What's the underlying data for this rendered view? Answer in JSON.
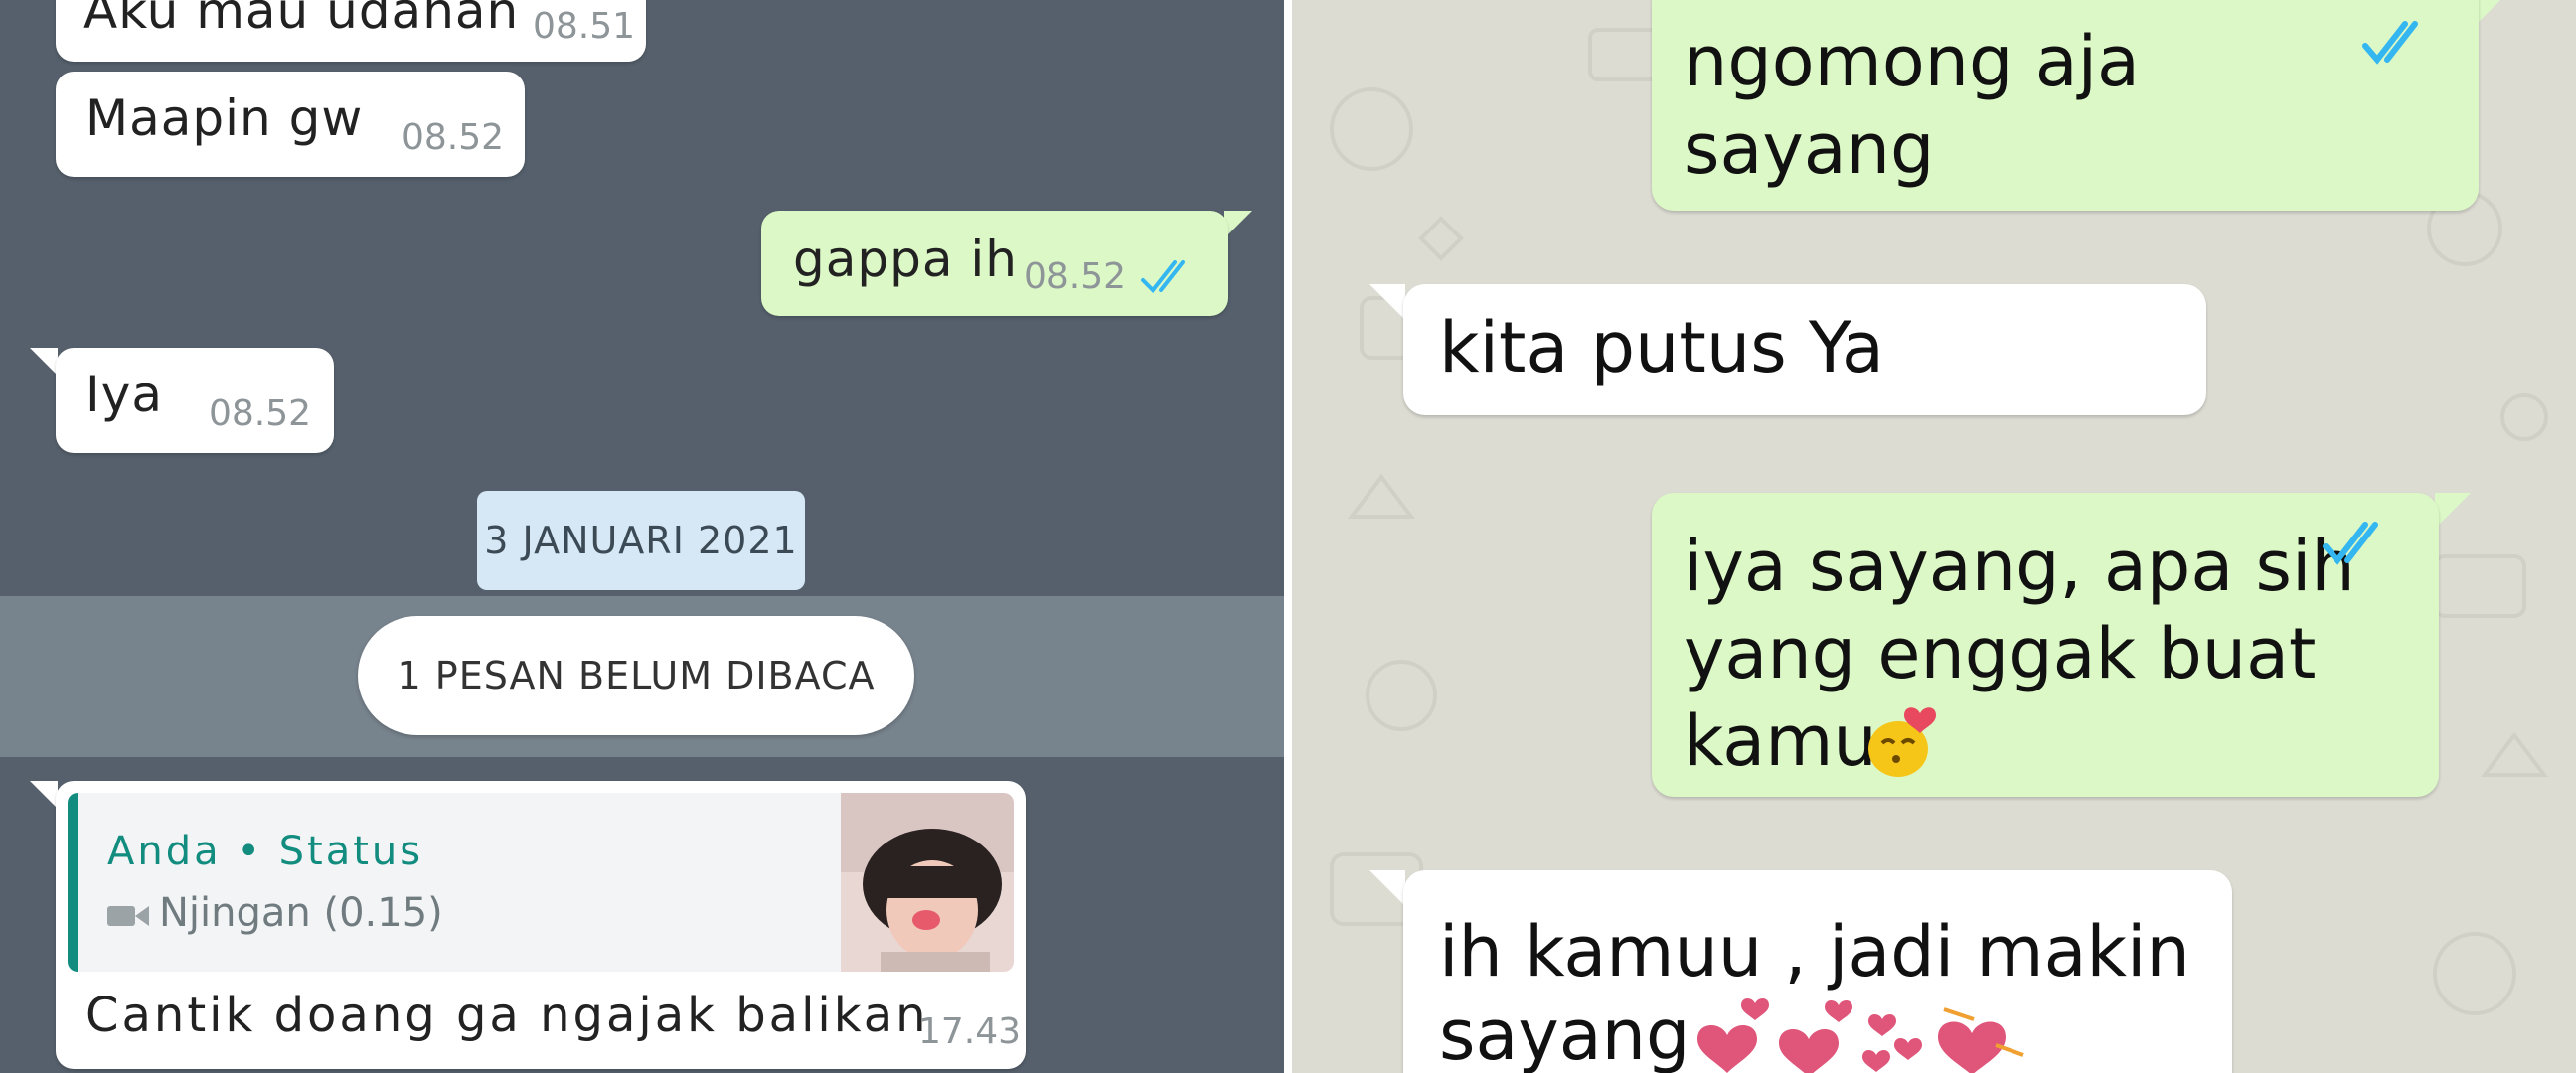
{
  "left_chat": {
    "messages": [
      {
        "text": "Aku mau udahan",
        "time": "08.51",
        "direction": "incoming"
      },
      {
        "text": "Maapin gw",
        "time": "08.52",
        "direction": "incoming"
      },
      {
        "text": "gappa ih",
        "time": "08.52",
        "direction": "outgoing",
        "status": "read"
      },
      {
        "text": "Iya",
        "time": "08.52",
        "direction": "incoming"
      }
    ],
    "date_separator": "3 JANUARI 2021",
    "unread_banner": "1 PESAN BELUM DIBACA",
    "status_reply": {
      "quoted_author": "Anda • Status",
      "quoted_media_icon": "video-camera-icon",
      "quoted_media": "Njingan (0.15)",
      "text": "Cantik doang ga ngajak balikan",
      "time": "17.43"
    },
    "colors": {
      "background": "#55606c",
      "incoming": "#ffffff",
      "outgoing": "#dcf8c6",
      "read_ticks": "#34b7f1",
      "quote_accent": "#128c7e"
    }
  },
  "right_chat": {
    "messages": [
      {
        "lines": [
          "ngomong aja",
          "sayang"
        ],
        "direction": "outgoing",
        "status": "read"
      },
      {
        "lines": [
          "kita putus Ya"
        ],
        "direction": "incoming"
      },
      {
        "lines": [
          "iya sayang, apa sih",
          "yang enggak buat",
          "kamu"
        ],
        "direction": "outgoing",
        "status": "read",
        "emoji": "kissing-face-icon"
      },
      {
        "lines": [
          "ih kamuu , jadi makin",
          "sayang"
        ],
        "direction": "incoming",
        "emoji": "hearts-icon"
      }
    ],
    "colors": {
      "background": "#dcdcd3",
      "incoming": "#ffffff",
      "outgoing": "#dcf8c6",
      "read_ticks": "#34b7f1"
    }
  }
}
